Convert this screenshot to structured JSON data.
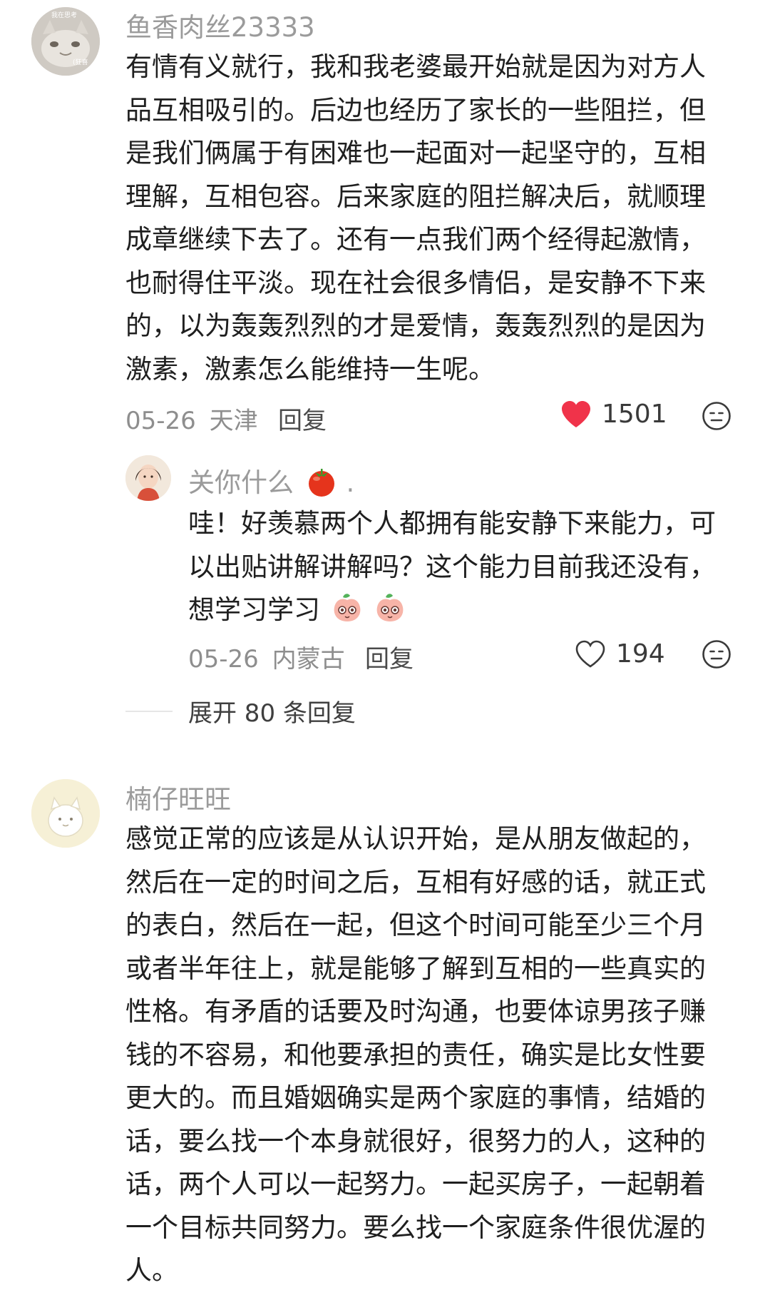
{
  "comments": [
    {
      "username": "鱼香肉丝23333",
      "avatar_text_top": "我在思考",
      "avatar_text_bottom": "(狂喜",
      "lines": [
        "有情有义就行，我和我老婆最开始就是因为对方人",
        "品互相吸引的。后边也经历了家长的一些阻拦，但",
        "是我们俩属于有困难也一起面对一起坚守的，互相",
        "理解，互相包容。后来家庭的阻拦解决后，就顺理",
        "成章继续下去了。还有一点我们两个经得起激情，",
        "也耐得住平淡。现在社会很多情侣，是安静不下来",
        "的，以为轰轰烈烈的才是爱情，轰轰烈烈的是因为",
        "激素，激素怎么能维持一生呢。"
      ],
      "date": "05-26",
      "location": "天津",
      "reply_label": "回复",
      "likes": "1501",
      "liked": true,
      "like_color": "#f0334a",
      "reply": {
        "username": "关你什么",
        "username_suffix": ".",
        "lines": [
          "哇！好羡慕两个人都拥有能安静下来能力，可",
          "以出贴讲解讲解吗？这个能力目前我还没有，",
          "想学习学习"
        ],
        "date": "05-26",
        "location": "内蒙古",
        "reply_label": "回复",
        "likes": "194",
        "liked": false
      },
      "expand_label": "展开 80 条回复"
    },
    {
      "username": "楠仔旺旺",
      "lines": [
        "感觉正常的应该是从认识开始，是从朋友做起的，",
        "然后在一定的时间之后，互相有好感的话，就正式",
        "的表白，然后在一起，但这个时间可能至少三个月",
        "或者半年往上，就是能够了解到互相的一些真实的",
        "性格。有矛盾的话要及时沟通，也要体谅男孩子赚",
        "钱的不容易，和他要承担的责任，确实是比女性要",
        "更大的。而且婚姻确实是两个家庭的事情，结婚的",
        "话，要么找一个本身就很好，很努力的人，这种的",
        "话，两个人可以一起努力。一起买房子，一起朝着",
        "一个目标共同努力。要么找一个家庭条件很优渥的",
        "人。"
      ]
    }
  ],
  "icons": {
    "like": "heart-icon",
    "react": "face-emoji-icon",
    "tomato": "tomato-emoji",
    "peach": "peach-emoji"
  }
}
